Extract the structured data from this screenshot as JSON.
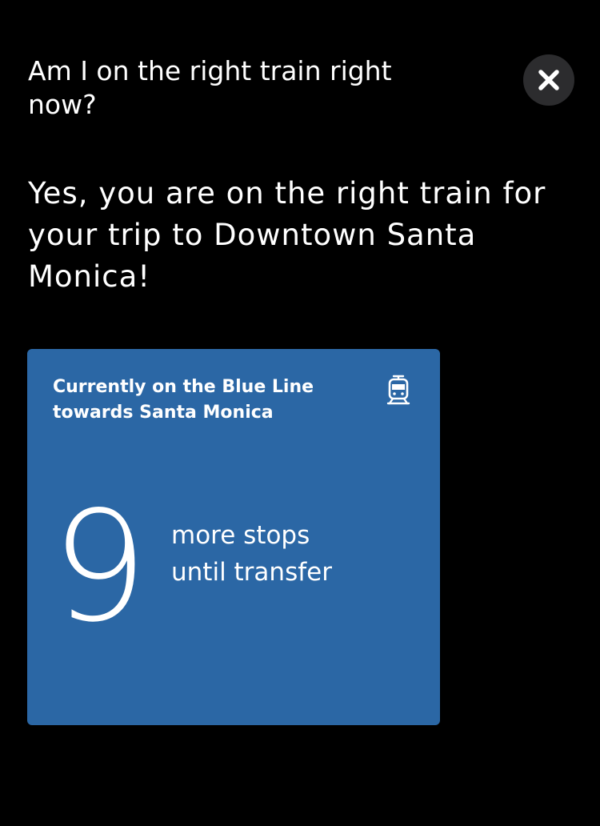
{
  "question": "Am I on the right train right now?",
  "answer": "Yes, you are on the right train for your trip to Downtown Santa Monica!",
  "close_icon": "close-icon",
  "card": {
    "title": "Currently on the Blue Line towards Santa Monica",
    "icon": "train-icon",
    "background": "#2b67a5",
    "stops_count": "9",
    "stops_line1": "more stops",
    "stops_line2": "until transfer"
  },
  "colors": {
    "page_background": "#000000",
    "close_button_background": "#2c2c2e",
    "text": "#ffffff"
  }
}
